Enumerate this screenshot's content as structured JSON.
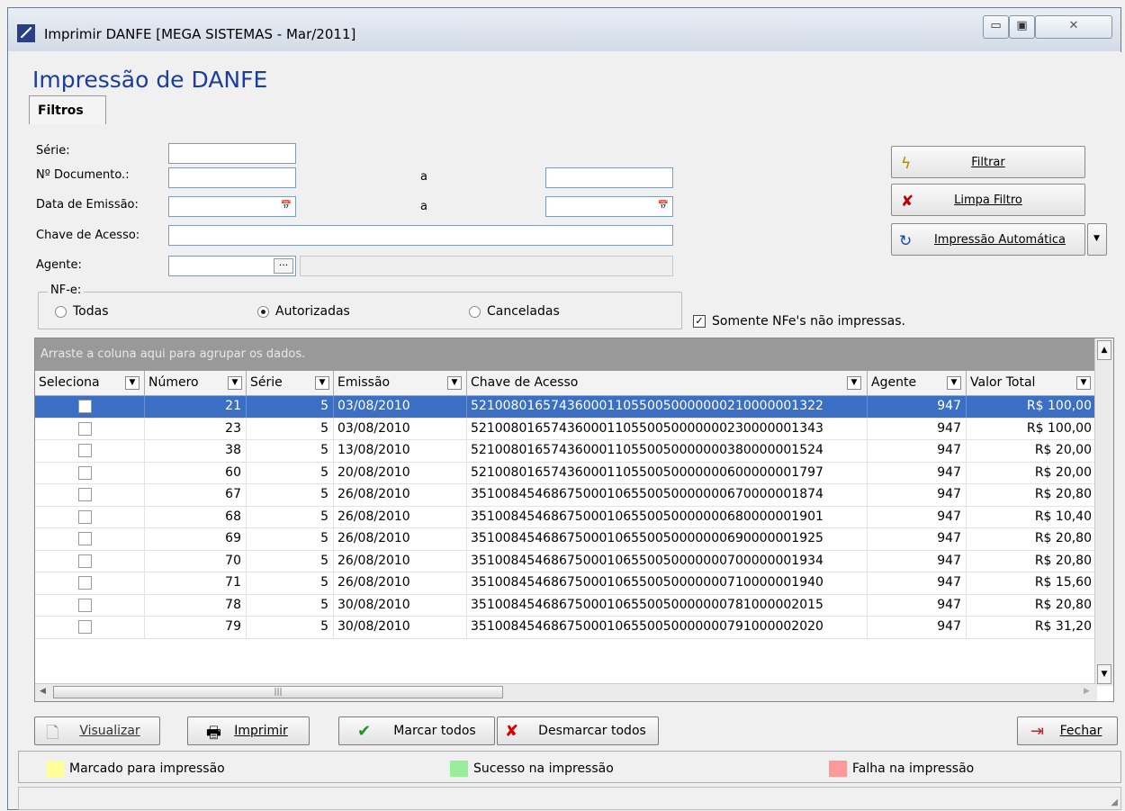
{
  "window": {
    "title": "Imprimir DANFE [MEGA SISTEMAS - Mar/2011]",
    "minimize": "▭",
    "maximize": "▣",
    "close": "✕"
  },
  "heading": "Impressão de DANFE",
  "tab": "Filtros",
  "filters": {
    "serie_label": "Série:",
    "documento_label": "Nº Documento.:",
    "emissao_label": "Data de Emissão:",
    "a_label": "a",
    "chave_label": "Chave de Acesso:",
    "agente_label": "Agente:",
    "nfe_legend": "NF-e:",
    "radios": [
      "Todas",
      "Autorizadas",
      "Canceladas"
    ],
    "selected_radio": "Autorizadas",
    "somente_label": "Somente NFe's não impressas.",
    "somente_checked": true
  },
  "side_buttons": {
    "filtrar": "Filtrar",
    "limpa": "Limpa Filtro",
    "auto": "Impressão Automática"
  },
  "grid": {
    "group_hint": "Arraste a coluna aqui para agrupar os dados.",
    "columns": [
      "Seleciona",
      "Número",
      "Série",
      "Emissão",
      "Chave de Acesso",
      "Agente",
      "Valor Total"
    ],
    "rows": [
      {
        "numero": "21",
        "serie": "5",
        "emissao": "03/08/2010",
        "chave": "52100801657436000110550050000000210000001322",
        "agente": "947",
        "valor": "R$ 100,00"
      },
      {
        "numero": "23",
        "serie": "5",
        "emissao": "03/08/2010",
        "chave": "52100801657436000110550050000000230000001343",
        "agente": "947",
        "valor": "R$ 100,00"
      },
      {
        "numero": "38",
        "serie": "5",
        "emissao": "13/08/2010",
        "chave": "52100801657436000110550050000000380000001524",
        "agente": "947",
        "valor": "R$ 20,00"
      },
      {
        "numero": "60",
        "serie": "5",
        "emissao": "20/08/2010",
        "chave": "52100801657436000110550050000000600000001797",
        "agente": "947",
        "valor": "R$ 20,00"
      },
      {
        "numero": "67",
        "serie": "5",
        "emissao": "26/08/2010",
        "chave": "35100845468675000106550050000000670000001874",
        "agente": "947",
        "valor": "R$ 20,80"
      },
      {
        "numero": "68",
        "serie": "5",
        "emissao": "26/08/2010",
        "chave": "35100845468675000106550050000000680000001901",
        "agente": "947",
        "valor": "R$ 10,40"
      },
      {
        "numero": "69",
        "serie": "5",
        "emissao": "26/08/2010",
        "chave": "35100845468675000106550050000000690000001925",
        "agente": "947",
        "valor": "R$ 20,80"
      },
      {
        "numero": "70",
        "serie": "5",
        "emissao": "26/08/2010",
        "chave": "35100845468675000106550050000000700000001934",
        "agente": "947",
        "valor": "R$ 20,80"
      },
      {
        "numero": "71",
        "serie": "5",
        "emissao": "26/08/2010",
        "chave": "35100845468675000106550050000000710000001940",
        "agente": "947",
        "valor": "R$ 15,60"
      },
      {
        "numero": "78",
        "serie": "5",
        "emissao": "30/08/2010",
        "chave": "35100845468675000106550050000000781000002015",
        "agente": "947",
        "valor": "R$ 20,80"
      },
      {
        "numero": "79",
        "serie": "5",
        "emissao": "30/08/2010",
        "chave": "35100845468675000106550050000000791000002020",
        "agente": "947",
        "valor": "R$ 31,20"
      }
    ],
    "selected_row": 0
  },
  "bottom_buttons": {
    "visualizar": "Visualizar",
    "imprimir": "Imprimir",
    "marcar": "Marcar todos",
    "desmarcar": "Desmarcar todos",
    "fechar": "Fechar"
  },
  "legend_items": [
    {
      "label": "Marcado para impressão",
      "color": "#ffff99"
    },
    {
      "label": "Sucesso na impressão",
      "color": "#99ee99"
    },
    {
      "label": "Falha na impressão",
      "color": "#ff9999"
    }
  ],
  "colors": {
    "selection": "#3b6fc4",
    "heading": "#1a3d9e",
    "groupbar": "#999999"
  }
}
